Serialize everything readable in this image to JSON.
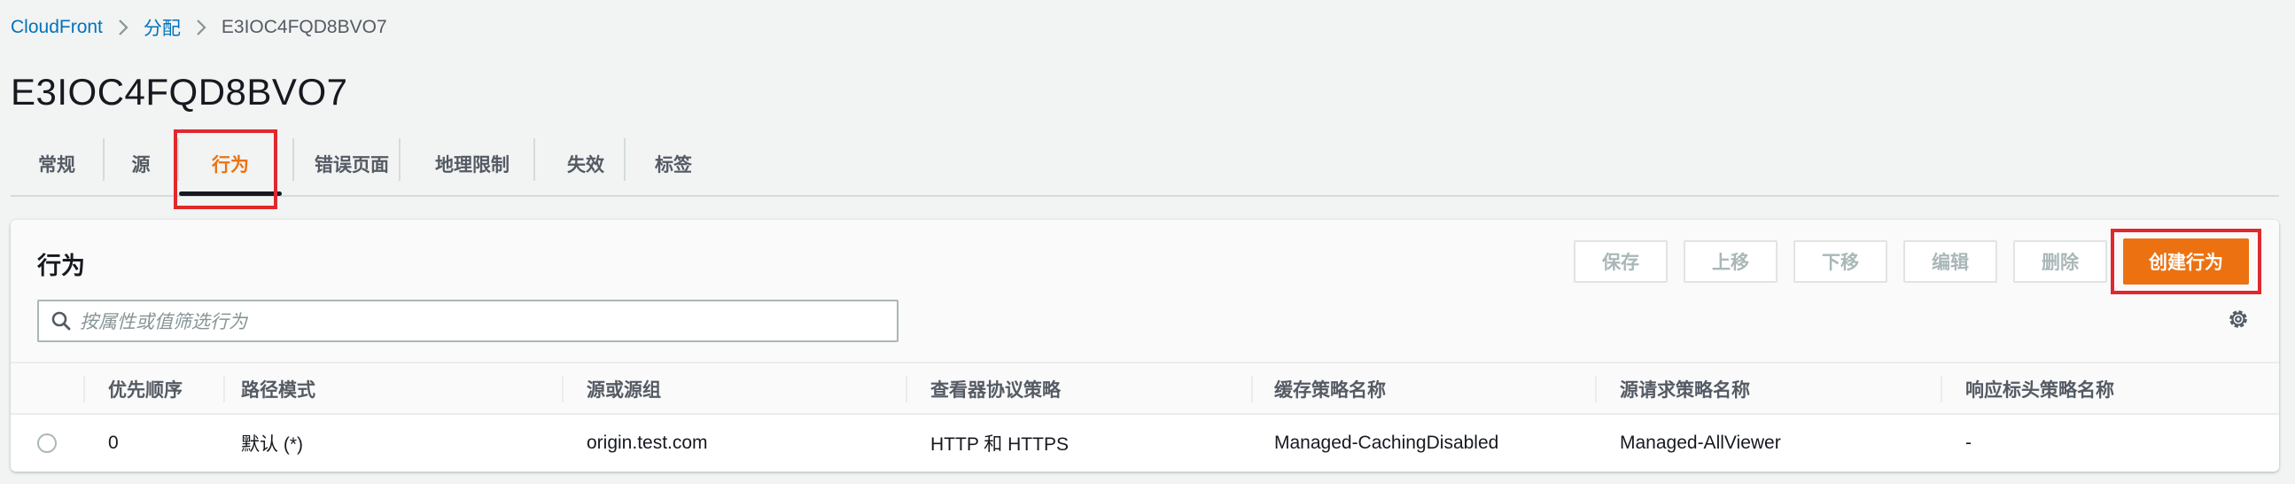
{
  "breadcrumb": {
    "items": [
      "CloudFront",
      "分配"
    ],
    "current": "E3IOC4FQD8BVO7"
  },
  "page": {
    "title": "E3IOC4FQD8BVO7"
  },
  "tabs": [
    {
      "label": "常规"
    },
    {
      "label": "源"
    },
    {
      "label": "行为",
      "active": true
    },
    {
      "label": "错误页面"
    },
    {
      "label": "地理限制"
    },
    {
      "label": "失效"
    },
    {
      "label": "标签"
    }
  ],
  "panel": {
    "title": "行为",
    "buttons": {
      "save": "保存",
      "move_up": "上移",
      "move_down": "下移",
      "edit": "编辑",
      "delete": "删除",
      "create": "创建行为"
    },
    "search": {
      "placeholder": "按属性或值筛选行为"
    }
  },
  "table": {
    "columns": [
      "优先顺序",
      "路径模式",
      "源或源组",
      "查看器协议策略",
      "缓存策略名称",
      "源请求策略名称",
      "响应标头策略名称"
    ],
    "rows": [
      [
        "0",
        "默认 (*)",
        "origin.test.com",
        "HTTP 和 HTTPS",
        "Managed-CachingDisabled",
        "Managed-AllViewer",
        "-"
      ]
    ]
  },
  "colors": {
    "accent": "#ec7211",
    "link": "#0073bb",
    "highlight": "#e1282d"
  }
}
